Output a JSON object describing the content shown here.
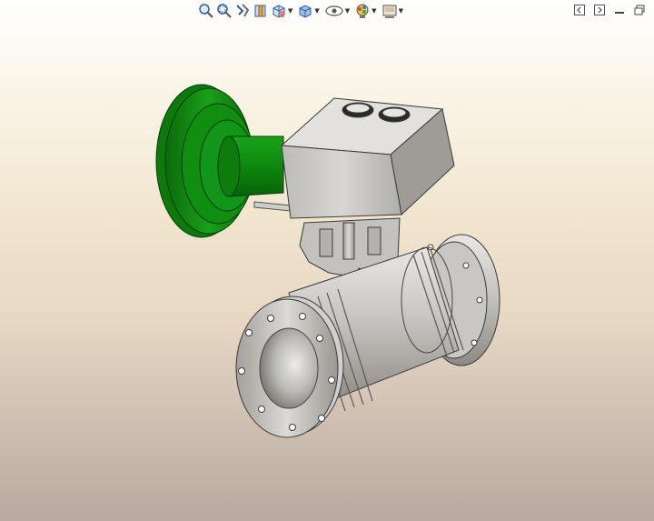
{
  "app": {
    "accent_color": "#0a7f0a",
    "model_color": "#b9b7b3",
    "background_top": "#ffffff",
    "background_bottom": "#b7a99f"
  },
  "heads_up_toolbar": {
    "items": [
      {
        "name": "zoom-to-fit-icon",
        "dropdown": false
      },
      {
        "name": "zoom-to-area-icon",
        "dropdown": false
      },
      {
        "name": "previous-view-icon",
        "dropdown": false
      },
      {
        "name": "section-view-icon",
        "dropdown": false
      },
      {
        "name": "view-orientation-icon",
        "dropdown": true
      },
      {
        "name": "display-style-icon",
        "dropdown": true
      },
      {
        "name": "hide-show-items-icon",
        "dropdown": true
      },
      {
        "name": "edit-appearance-icon",
        "dropdown": true
      },
      {
        "name": "apply-scene-icon",
        "dropdown": true
      }
    ]
  },
  "window_controls": [
    {
      "name": "tile-left-icon"
    },
    {
      "name": "tile-right-icon"
    },
    {
      "name": "minimize-icon"
    },
    {
      "name": "restore-icon"
    }
  ],
  "model": {
    "description_visible": false,
    "parts": [
      "pneumatic-actuator",
      "actuator-stem",
      "positioner-housing",
      "yoke-bracket",
      "valve-body",
      "inlet-flange",
      "outlet-flange"
    ]
  }
}
